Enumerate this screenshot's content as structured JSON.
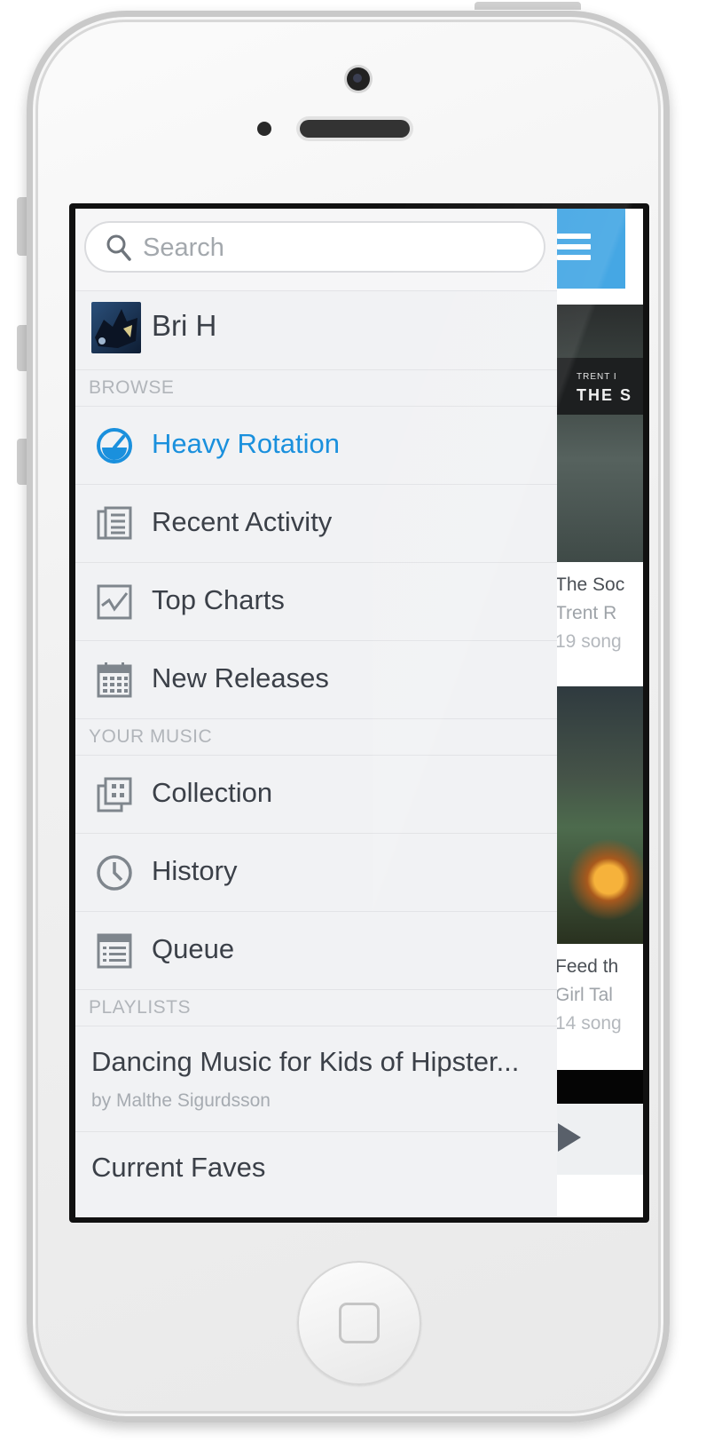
{
  "search": {
    "placeholder": "Search"
  },
  "profile": {
    "name": "Bri H"
  },
  "sections": {
    "browse": "BROWSE",
    "your_music": "YOUR MUSIC",
    "playlists": "PLAYLISTS"
  },
  "browse_items": [
    {
      "label": "Heavy Rotation",
      "icon": "gauge-icon",
      "active": true
    },
    {
      "label": "Recent Activity",
      "icon": "newspaper-icon"
    },
    {
      "label": "Top Charts",
      "icon": "chart-icon"
    },
    {
      "label": "New Releases",
      "icon": "calendar-icon"
    }
  ],
  "music_items": [
    {
      "label": "Collection",
      "icon": "collection-icon"
    },
    {
      "label": "History",
      "icon": "clock-icon"
    },
    {
      "label": "Queue",
      "icon": "queue-list-icon"
    }
  ],
  "playlists": [
    {
      "title": "Dancing Music for Kids of Hipster...",
      "subtitle": "by Malthe Sigurdsson"
    },
    {
      "title": "Current Faves"
    }
  ],
  "albums": [
    {
      "cover_small": "TRENT I",
      "cover_big": "THE S",
      "title": "The Soc",
      "artist": "Trent R",
      "count": "19 song"
    },
    {
      "title": "Feed th",
      "artist": "Girl Tal",
      "count": "14 song"
    }
  ],
  "colors": {
    "accent": "#1a90dd",
    "menu_button": "#45a7e4",
    "text": "#3b4048",
    "muted": "#a6abb1"
  }
}
